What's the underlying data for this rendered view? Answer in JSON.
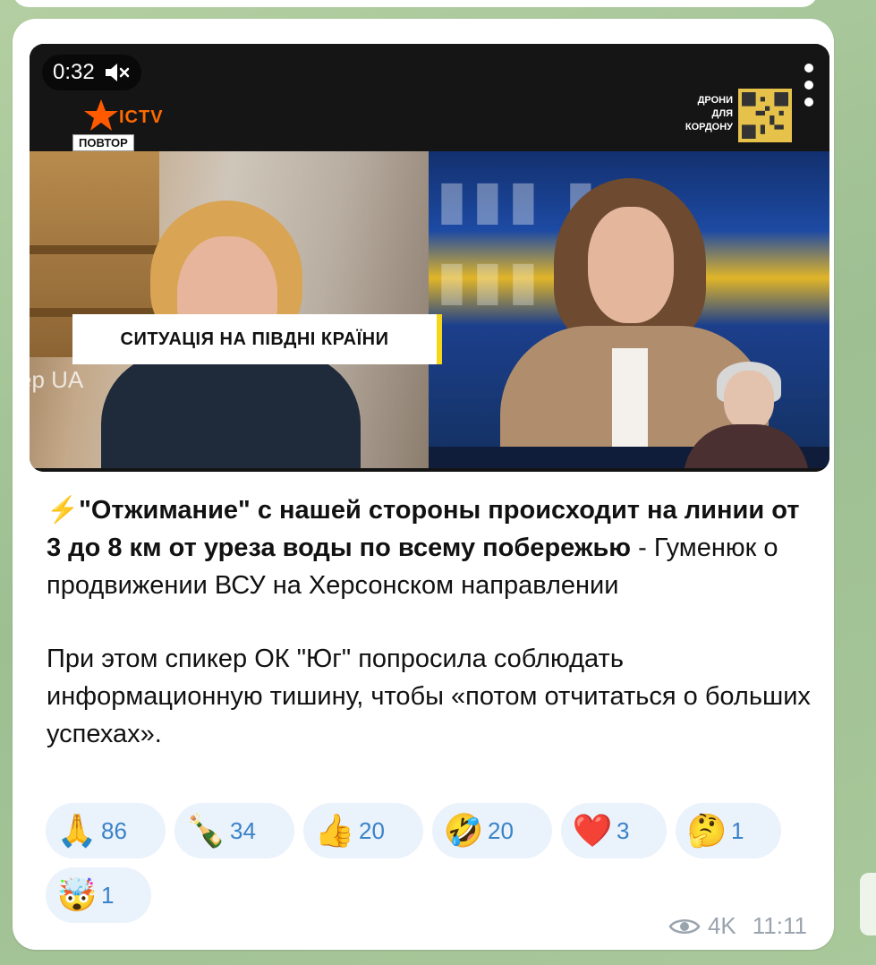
{
  "video": {
    "duration": "0:32",
    "channel_logo": "ICTV",
    "badge": "ПОВТОР",
    "promo_lines": [
      "ДРОНИ",
      "ДЛЯ",
      "КОРДОНУ"
    ],
    "lower_third": "СИТУАЦІЯ НА ПІВДНІ КРАЇНИ",
    "watermark": "ер UA",
    "mute_icon": "speaker-muted-icon",
    "more_icon": "more-vertical-icon"
  },
  "message": {
    "bolt": "⚡",
    "bold_text": "\"Отжимание\" с нашей стороны происходит на линии от 3 до 8 км от уреза воды по всему побережью",
    "normal_text": " - Гуменюк о продвижении ВСУ на Херсонском направлении",
    "paragraph2": "При этом спикер ОК \"Юг\" попросила соблюдать информационную тишину, чтобы «потом отчитаться о больших успехах»."
  },
  "reactions": [
    {
      "emoji": "🙏",
      "count": "86"
    },
    {
      "emoji": "🍾",
      "count": "34"
    },
    {
      "emoji": "👍",
      "count": "20"
    },
    {
      "emoji": "🤣",
      "count": "20"
    },
    {
      "emoji": "❤️",
      "count": "3"
    },
    {
      "emoji": "🤔",
      "count": "1"
    },
    {
      "emoji": "🤯",
      "count": "1"
    }
  ],
  "meta": {
    "views": "4K",
    "time": "11:11"
  },
  "colors": {
    "bubble": "#ffffff",
    "reaction_bg": "#eaf2fb",
    "reaction_count": "#3a82c8",
    "meta": "#9aa4ae",
    "lower_third_accent": "#f4d71a"
  }
}
